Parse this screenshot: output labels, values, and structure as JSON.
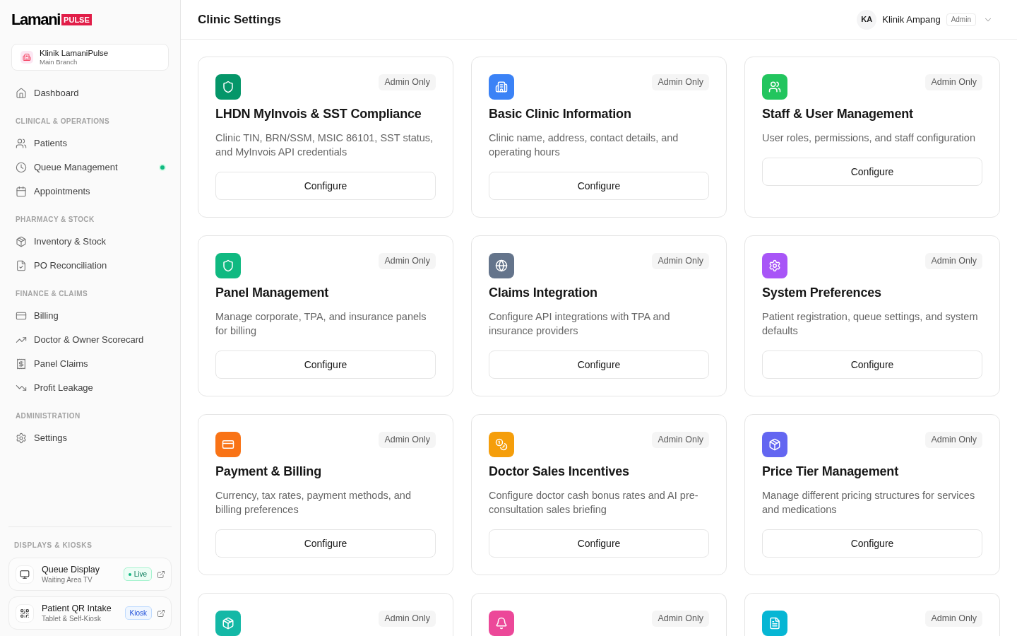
{
  "sidebar": {
    "logo": {
      "word": "Lamani",
      "tag": "PULSE"
    },
    "clinic": {
      "name": "Klinik LamaniPulse",
      "branch": "Main Branch"
    },
    "nav_groups": [
      {
        "items": [
          {
            "label": "Dashboard",
            "selected": false,
            "status_dot": false
          }
        ]
      },
      {
        "heading": "CLINICAL & OPERATIONS",
        "items": [
          {
            "label": "Patients",
            "selected": false,
            "status_dot": false
          },
          {
            "label": "Queue Management",
            "selected": false,
            "status_dot": true
          },
          {
            "label": "Appointments",
            "selected": false,
            "status_dot": false
          }
        ]
      },
      {
        "heading": "PHARMACY & STOCK",
        "items": [
          {
            "label": "Inventory & Stock",
            "selected": false,
            "status_dot": false
          },
          {
            "label": "PO Reconciliation",
            "selected": false,
            "status_dot": false
          }
        ]
      },
      {
        "heading": "FINANCE & CLAIMS",
        "items": [
          {
            "label": "Billing",
            "selected": false,
            "status_dot": false
          },
          {
            "label": "Doctor & Owner Scorecard",
            "selected": false,
            "status_dot": false
          },
          {
            "label": "Panel Claims",
            "selected": false,
            "status_dot": false
          },
          {
            "label": "Profit Leakage",
            "selected": false,
            "status_dot": false
          }
        ]
      },
      {
        "heading": "ADMINISTRATION",
        "items": [
          {
            "label": "Settings",
            "selected": false,
            "status_dot": false
          }
        ]
      }
    ],
    "displays": {
      "heading": "DISPLAYS & KIOSKS",
      "items": [
        {
          "title": "Queue Display",
          "subtitle": "Waiting Area TV",
          "badge": {
            "label": "Live",
            "kind": "live"
          }
        },
        {
          "title": "Patient QR Intake",
          "subtitle": "Tablet & Self-Kiosk",
          "badge": {
            "label": "Kiosk",
            "kind": "kiosk"
          }
        }
      ]
    }
  },
  "header": {
    "title": "Clinic Settings",
    "user": {
      "initials": "KA",
      "name": "Klinik Ampang",
      "role": "Admin"
    }
  },
  "cards": [
    {
      "color": "#059669",
      "badge": "Admin Only",
      "title": "LHDN MyInvois & SST Compliance",
      "description": "Clinic TIN, BRN/SSM, MSIC 86101, SST status, and MyInvois API credentials",
      "button": "Configure"
    },
    {
      "color": "#3b82f6",
      "badge": "Admin Only",
      "title": "Basic Clinic Information",
      "description": "Clinic name, address, contact details, and operating hours",
      "button": "Configure"
    },
    {
      "color": "#22c55e",
      "badge": "Admin Only",
      "title": "Staff & User Management",
      "description": "User roles, permissions, and staff configuration",
      "button": "Configure"
    },
    {
      "color": "#10b981",
      "badge": "Admin Only",
      "title": "Panel Management",
      "description": "Manage corporate, TPA, and insurance panels for billing",
      "button": "Configure"
    },
    {
      "color": "#64748b",
      "badge": "Admin Only",
      "title": "Claims Integration",
      "description": "Configure API integrations with TPA and insurance providers",
      "button": "Configure"
    },
    {
      "color": "#a855f7",
      "badge": "Admin Only",
      "title": "System Preferences",
      "description": "Patient registration, queue settings, and system defaults",
      "button": "Configure"
    },
    {
      "color": "#f97316",
      "badge": "Admin Only",
      "title": "Payment & Billing",
      "description": "Currency, tax rates, payment methods, and billing preferences",
      "button": "Configure"
    },
    {
      "color": "#f59e0b",
      "badge": "Admin Only",
      "title": "Doctor Sales Incentives",
      "description": "Configure doctor cash bonus rates and AI pre-consultation sales briefing",
      "button": "Configure"
    },
    {
      "color": "#6366f1",
      "badge": "Admin Only",
      "title": "Price Tier Management",
      "description": "Manage different pricing structures for services and medications",
      "button": "Configure"
    },
    {
      "color": "#14b8a6",
      "badge": "Admin Only"
    },
    {
      "color": "#ec4899",
      "badge": "Admin Only"
    },
    {
      "color": "#06b6d4",
      "badge": "Admin Only"
    }
  ]
}
